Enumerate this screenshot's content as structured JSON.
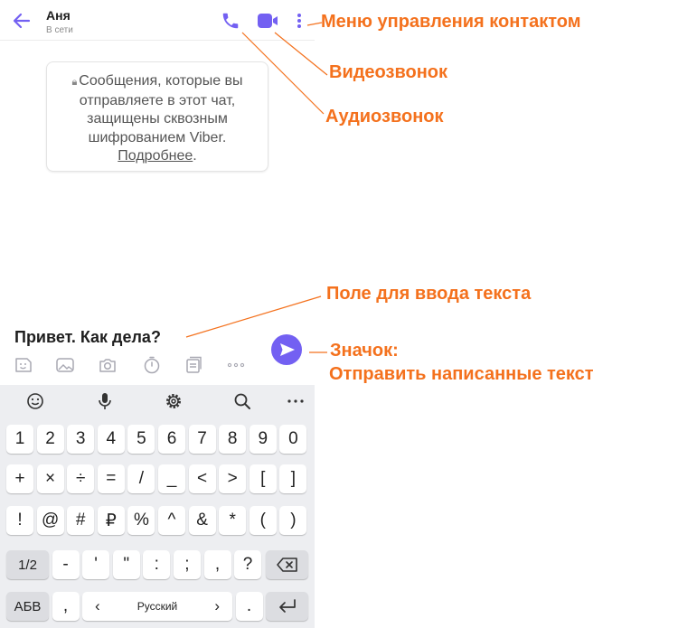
{
  "colors": {
    "accent": "#7360f2",
    "annotation": "#f4711d",
    "keyboard_bg": "#edeef1"
  },
  "header": {
    "contact_name": "Аня",
    "status": "В сети",
    "icons": [
      "back-arrow-icon",
      "phone-icon",
      "video-camera-icon",
      "more-vertical-icon"
    ]
  },
  "chat": {
    "notice_text": "Сообщения, которые вы отправляете в этот чат, защищены сквозным шифрованием Viber.",
    "notice_link": "Подробнее",
    "notice_end": "."
  },
  "composer": {
    "input_value": "Привет. Как дела?",
    "attach_icons": [
      "sticker-icon",
      "gallery-icon",
      "camera-icon",
      "timer-icon",
      "notes-icon",
      "more-horizontal-icon"
    ]
  },
  "keyboard": {
    "toolbar_icons": [
      "emoji-icon",
      "microphone-icon",
      "settings-icon",
      "search-icon",
      "more-horizontal-icon"
    ],
    "row1": [
      "1",
      "2",
      "3",
      "4",
      "5",
      "6",
      "7",
      "8",
      "9",
      "0"
    ],
    "row2": [
      "+",
      "×",
      "÷",
      "=",
      "/",
      "_",
      "<",
      ">",
      "[",
      "]"
    ],
    "row3": [
      "!",
      "@",
      "#",
      "₽",
      "%",
      "^",
      "&",
      "*",
      "(",
      ")"
    ],
    "row4": {
      "shift": "1/2",
      "keys": [
        "-",
        "'",
        "\"",
        ":",
        ";",
        ",",
        "?"
      ],
      "backspace": "backspace-icon"
    },
    "row5": {
      "layout": "АБВ",
      "comma": ",",
      "space_left": "‹",
      "space_label": "Русский",
      "space_right": "›",
      "period": ".",
      "enter": "enter-icon"
    }
  },
  "annotations": {
    "menu": "Меню управления контактом",
    "video": "Видеозвонок",
    "audio": "Аудиозвонок",
    "text_field": "Поле для ввода текста",
    "send_line1": "Значок:",
    "send_line2": "Отправить написанные текст"
  }
}
